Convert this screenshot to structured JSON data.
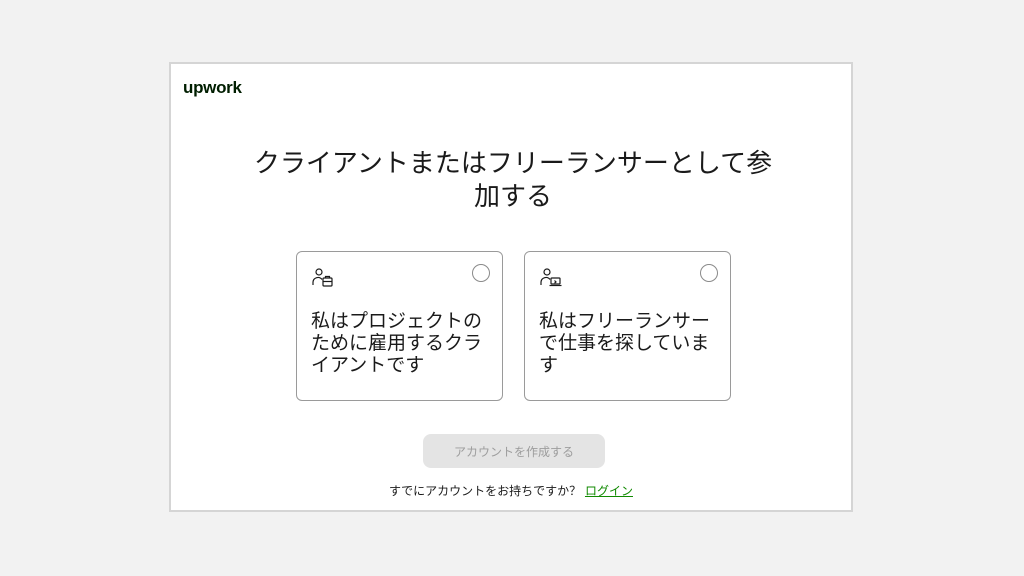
{
  "logo": {
    "text": "upwork",
    "color": "#001e00"
  },
  "heading": "クライアントまたはフリーランサーとして参加する",
  "options": [
    {
      "id": "client",
      "icon": "client-briefcase-icon",
      "label": "私はプロジェクトのために雇用するクライアントです",
      "selected": false
    },
    {
      "id": "freelancer",
      "icon": "freelancer-laptop-icon",
      "label": "私はフリーランサーで仕事を探しています",
      "selected": false
    }
  ],
  "create_button": {
    "label": "アカウントを作成する",
    "disabled": true
  },
  "login": {
    "prompt": "すでにアカウントをお持ちですか？",
    "link_label": "ログイン",
    "link_color": "#108a00"
  }
}
